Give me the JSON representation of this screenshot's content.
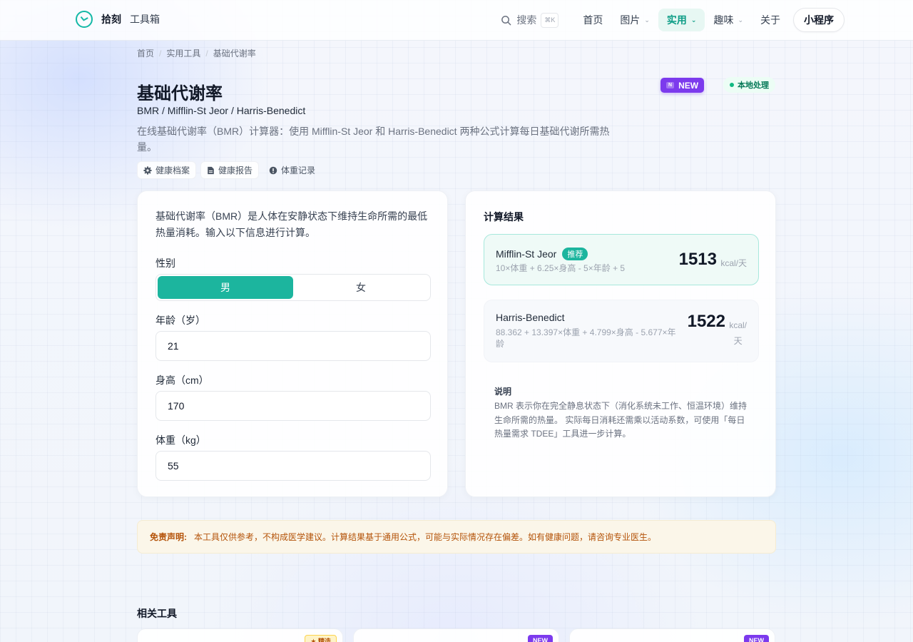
{
  "nav": {
    "brand_name": "拾刻",
    "brand_sub": "工具箱",
    "search_label": "搜索",
    "search_kbd": "⌘K",
    "items": [
      {
        "label": "首页",
        "has_menu": false,
        "active": false
      },
      {
        "label": "图片",
        "has_menu": true,
        "active": false
      },
      {
        "label": "实用",
        "has_menu": true,
        "active": true
      },
      {
        "label": "趣味",
        "has_menu": true,
        "active": false
      },
      {
        "label": "关于",
        "has_menu": false,
        "active": false
      }
    ],
    "mini_program_label": "小程序"
  },
  "breadcrumb": [
    "首页",
    "实用工具",
    "基础代谢率"
  ],
  "header": {
    "title": "基础代谢率",
    "subtitle": "BMR / Mifflin-St Jeor / Harris-Benedict",
    "description": "在线基础代谢率（BMR）计算器：使用 Mifflin-St Jeor 和 Harris-Benedict 两种公式计算每日基础代谢所需热量。",
    "badge_new": "NEW",
    "badge_new_icon": "N",
    "badge_local": "本地处理",
    "chips": [
      {
        "icon": "gear-icon",
        "label": "健康档案"
      },
      {
        "icon": "document-icon",
        "label": "健康报告"
      },
      {
        "icon": "info-icon",
        "label": "体重记录"
      }
    ]
  },
  "form": {
    "intro": "基础代谢率（BMR）是人体在安静状态下维持生命所需的最低热量消耗。输入以下信息进行计算。",
    "gender_label": "性别",
    "gender_options": [
      "男",
      "女"
    ],
    "gender_selected": "男",
    "age_label": "年龄（岁）",
    "age_value": "21",
    "height_label": "身高（cm）",
    "height_value": "170",
    "weight_label": "体重（kg）",
    "weight_value": "55"
  },
  "results": {
    "title": "计算结果",
    "mifflin": {
      "name": "Mifflin-St Jeor",
      "tag": "推荐",
      "formula": "10×体重 + 6.25×身高 - 5×年龄 + 5",
      "value": "1513",
      "unit": "kcal/天"
    },
    "harris": {
      "name": "Harris-Benedict",
      "formula": "88.362 + 13.397×体重 + 4.799×身高 - 5.677×年龄",
      "value": "1522",
      "unit_line1": "kcal/",
      "unit_line2": "天"
    },
    "note_title": "说明",
    "note_body": "BMR 表示你在完全静息状态下（消化系统未工作、恒温环境）维持生命所需的热量。 实际每日消耗还需乘以活动系数，可使用「每日热量需求 TDEE」工具进一步计算。"
  },
  "disclaimer": {
    "label": "免责声明:",
    "text": "本工具仅供参考，不构成医学建议。计算结果基于通用公式，可能与实际情况存在偏差。如有健康问题，请咨询专业医生。"
  },
  "related": {
    "title": "相关工具",
    "cards": [
      {
        "badge": "★ 精选"
      },
      {
        "badge": "NEW"
      },
      {
        "badge": "NEW"
      }
    ]
  },
  "colors": {
    "accent": "#1cb59e",
    "new_badge": "#7c3aed",
    "warning": "#b45309"
  }
}
